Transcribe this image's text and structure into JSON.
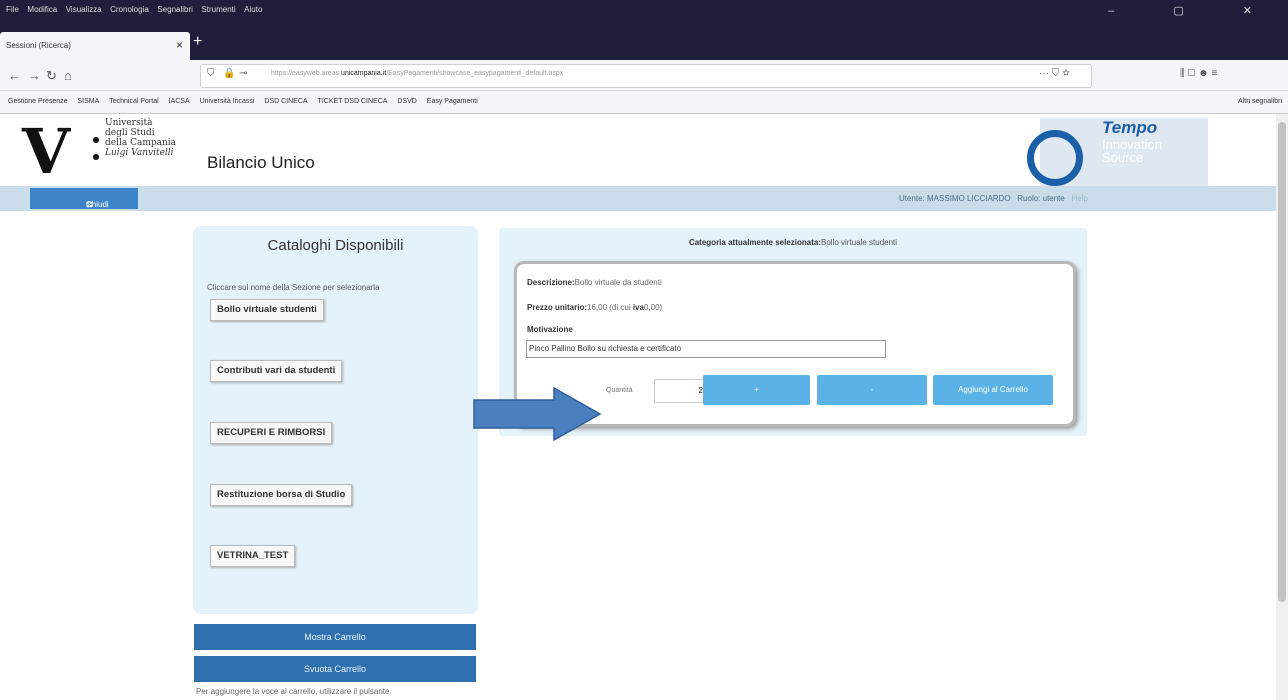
{
  "browser": {
    "menu": [
      "File",
      "Modifica",
      "Visualizza",
      "Cronologia",
      "Segnalibri",
      "Strumenti",
      "Aiuto"
    ],
    "window_controls": "–  ▢  ✕",
    "tab_title": "Sessioni (Ricerca)",
    "tab_close": "×",
    "new_tab": "+",
    "url_prefix": "https://easyweb.areas.",
    "url_domain": "unicampania.it",
    "url_suffix": "/EasyPagamenti/showcase_easypagamenti_default.aspx",
    "page_actions": "··· ⛉ ☆",
    "toolbar_right": "⫼  ▢  ☻   ≡",
    "bookmarks": [
      "Gestione Presenze",
      "SISMA",
      "Technical Portal",
      "IACSA",
      "Università Incassi",
      "DSD CINECA",
      "TICKET DSD CINECA",
      "DSVD",
      "Easy Pagamenti"
    ],
    "other_bookmarks": "Altri segnalibri"
  },
  "header": {
    "logo_letter": "V",
    "university_lines": [
      "Università",
      "degli Studi",
      "della Campania",
      "Luigi Vanvitelli"
    ],
    "app_title": "Bilancio Unico",
    "partner_title": "Tempo",
    "partner_sub": [
      "Innovation",
      "Source"
    ]
  },
  "strip": {
    "close_button": "Chiudi",
    "close_icon": "⊠",
    "user_label": "Utente: MASSIMO LICCIARDO",
    "role_label": "Ruolo: utente",
    "help": "Help"
  },
  "catalog": {
    "title": "Cataloghi Disponibili",
    "hint": "Cliccare sul nome della Sezione per selezionarla",
    "items": [
      "Bollo virtuale studenti",
      "Contributi vari da studenti",
      "RECUPERI E RIMBORSI",
      "Restituzione borsa di Studio",
      "VETRINA_TEST"
    ],
    "show_cart": "Mostra Carrello",
    "empty_cart": "Svuota Carrello",
    "bottom_hint": "Per aggiungere la voce al carrello, utilizzare il pulsante"
  },
  "selection": {
    "heading_label": "Categoria attualmente selezionata:",
    "heading_value": "Bollo virtuale studenti",
    "desc_label": "Descrizione:",
    "desc_value": "Bollo virtuale da studenti",
    "price_label": "Prezzo unitario:",
    "price_value": "16,00 (di cui ",
    "iva_label": "iva",
    "iva_value": "0,00)",
    "motivation_label": "Motivazione",
    "motivation_value": "Pinco Pallino Bollo su richiesta e certificato",
    "qty_label": "Quantità",
    "qty_value": "2",
    "plus": "+",
    "minus": "-",
    "add_to_cart": "Aggiungi al Carrello"
  },
  "colors": {
    "browser_dark": "#1f1e3b",
    "strip_blue": "#c8dcea",
    "panel_light": "#e4f3fb",
    "button_blue": "#2e6fad",
    "action_blue": "#5ab2e6",
    "arrow_blue": "#4a7fc0"
  }
}
